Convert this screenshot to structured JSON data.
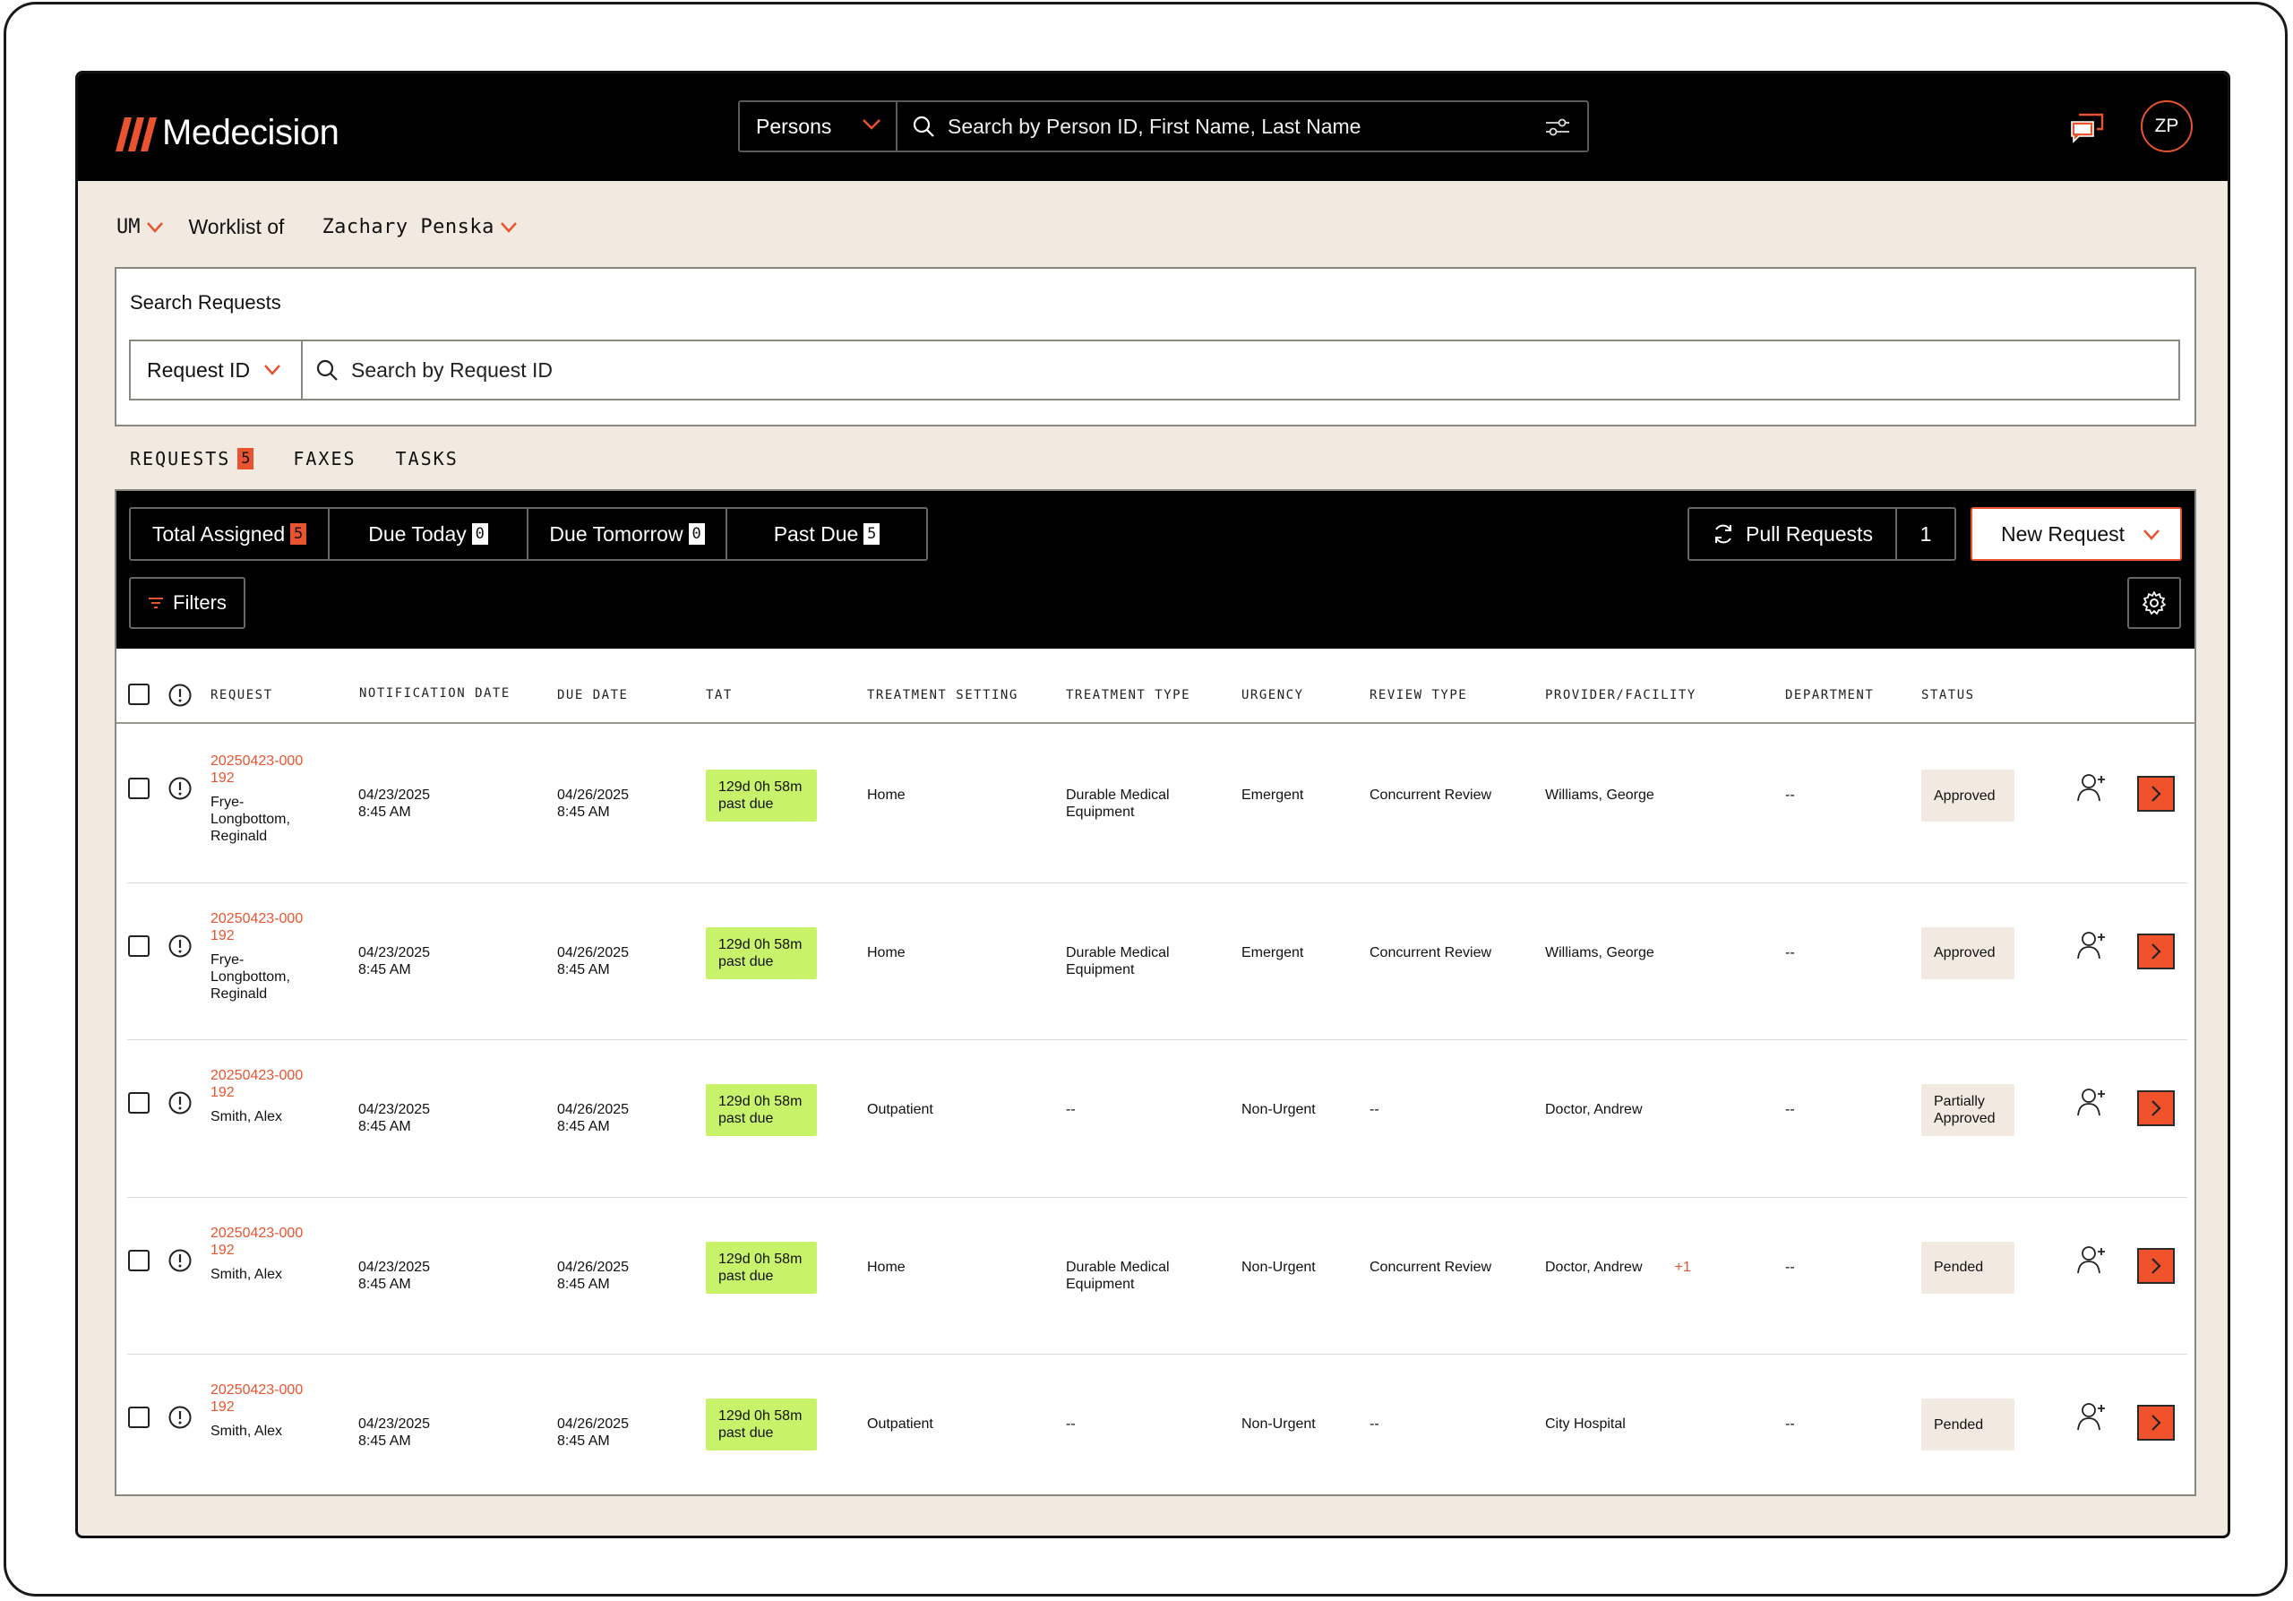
{
  "app": {
    "brand": "Medecision",
    "avatar_initials": "ZP",
    "brand_color": "#e8542f",
    "accent_green": "#c8f26a"
  },
  "global_search": {
    "scope": "Persons",
    "placeholder": "Search by Person ID, First Name, Last Name"
  },
  "worklist": {
    "module": "UM",
    "label": "Worklist of",
    "user": "Zachary Penska"
  },
  "search_requests": {
    "title": "Search Requests",
    "field": "Request ID",
    "placeholder": "Search by Request ID"
  },
  "tabs": [
    {
      "label": "REQUESTS",
      "badge": "5",
      "active": true
    },
    {
      "label": "FAXES"
    },
    {
      "label": "TASKS"
    }
  ],
  "counters": [
    {
      "label": "Total Assigned",
      "count": "5"
    },
    {
      "label": "Due Today",
      "count": "0"
    },
    {
      "label": "Due Tomorrow",
      "count": "0"
    },
    {
      "label": "Past Due",
      "count": "5"
    }
  ],
  "toolbar": {
    "pull_label": "Pull Requests",
    "pull_count": "1",
    "new_request": "New Request",
    "filters": "Filters"
  },
  "columns": [
    "REQUEST",
    "NOTIFICATION DATE",
    "DUE DATE",
    "TAT",
    "TREATMENT SETTING",
    "TREATMENT TYPE",
    "URGENCY",
    "REVIEW TYPE",
    "PROVIDER/FACILITY",
    "DEPARTMENT",
    "STATUS"
  ],
  "rows": [
    {
      "id1": "20250423-000",
      "id2": "192",
      "name1": "Frye-",
      "name2": "Longbottom,",
      "name3": "Reginald",
      "notif1": "04/23/2025",
      "notif2": "8:45 AM",
      "due1": "04/26/2025",
      "due2": "8:45 AM",
      "tat1": "129d 0h 58m",
      "tat2": "past due",
      "setting": "Home",
      "type1": "Durable Medical",
      "type2": "Equipment",
      "urgency": "Emergent",
      "review": "Concurrent Review",
      "provider": "Williams, George",
      "extra": "",
      "department": "--",
      "status1": "Approved",
      "status2": ""
    },
    {
      "id1": "20250423-000",
      "id2": "192",
      "name1": "Frye-",
      "name2": "Longbottom,",
      "name3": "Reginald",
      "notif1": "04/23/2025",
      "notif2": "8:45 AM",
      "due1": "04/26/2025",
      "due2": "8:45 AM",
      "tat1": "129d 0h 58m",
      "tat2": "past due",
      "setting": "Home",
      "type1": "Durable Medical",
      "type2": "Equipment",
      "urgency": "Emergent",
      "review": "Concurrent Review",
      "provider": "Williams, George",
      "extra": "",
      "department": "--",
      "status1": "Approved",
      "status2": ""
    },
    {
      "id1": "20250423-000",
      "id2": "192",
      "name1": "Smith, Alex",
      "name2": "",
      "name3": "",
      "notif1": "04/23/2025",
      "notif2": "8:45 AM",
      "due1": "04/26/2025",
      "due2": "8:45 AM",
      "tat1": "129d 0h 58m",
      "tat2": "past due",
      "setting": "Outpatient",
      "type1": "--",
      "type2": "",
      "urgency": "Non-Urgent",
      "review": "--",
      "provider": "Doctor, Andrew",
      "extra": "",
      "department": "--",
      "status1": "Partially",
      "status2": "Approved"
    },
    {
      "id1": "20250423-000",
      "id2": "192",
      "name1": "Smith, Alex",
      "name2": "",
      "name3": "",
      "notif1": "04/23/2025",
      "notif2": "8:45 AM",
      "due1": "04/26/2025",
      "due2": "8:45 AM",
      "tat1": "129d 0h 58m",
      "tat2": "past due",
      "setting": "Home",
      "type1": "Durable Medical",
      "type2": "Equipment",
      "urgency": "Non-Urgent",
      "review": "Concurrent Review",
      "provider": "Doctor, Andrew",
      "extra": "+1",
      "department": "--",
      "status1": "Pended",
      "status2": ""
    },
    {
      "id1": "20250423-000",
      "id2": "192",
      "name1": "Smith, Alex",
      "name2": "",
      "name3": "",
      "notif1": "04/23/2025",
      "notif2": "8:45 AM",
      "due1": "04/26/2025",
      "due2": "8:45 AM",
      "tat1": "129d 0h 58m",
      "tat2": "past due",
      "setting": "Outpatient",
      "type1": "--",
      "type2": "",
      "urgency": "Non-Urgent",
      "review": "--",
      "provider": "City Hospital",
      "extra": "",
      "department": "--",
      "status1": "Pended",
      "status2": ""
    }
  ]
}
